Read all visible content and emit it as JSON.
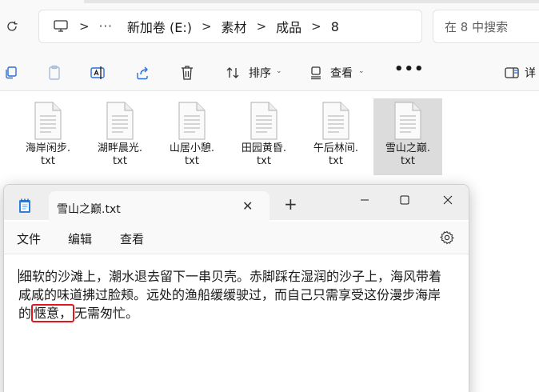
{
  "explorer": {
    "breadcrumb": {
      "more": "···",
      "separator": ">",
      "items": [
        "新加卷 (E:)",
        "素材",
        "成品",
        "8"
      ]
    },
    "search": {
      "placeholder": "在 8 中搜索"
    },
    "toolbar": {
      "sort_label": "排序",
      "view_label": "查看",
      "details_label": "详",
      "more_label": "•••"
    },
    "files": [
      {
        "line1": "海岸闲步.",
        "line2": "txt",
        "selected": false
      },
      {
        "line1": "湖畔晨光.",
        "line2": "txt",
        "selected": false
      },
      {
        "line1": "山居小憩.",
        "line2": "txt",
        "selected": false
      },
      {
        "line1": "田园黄昏.",
        "line2": "txt",
        "selected": false
      },
      {
        "line1": "午后林间.",
        "line2": "txt",
        "selected": false
      },
      {
        "line1": "雪山之巅.",
        "line2": "txt",
        "selected": true
      }
    ]
  },
  "notepad": {
    "tab_title": "雪山之巅.txt",
    "tab_close": "✕",
    "new_tab": "+",
    "menus": [
      "文件",
      "编辑",
      "查看"
    ],
    "content": {
      "line1": "细软的沙滩上，潮水退去留下一串贝壳。赤脚踩在湿润的沙子上，海风带着",
      "line2": "咸咸的味道拂过脸颊。远处的渔船缓缓驶过，而自己只需享受这份漫步海岸",
      "line3_before": "的",
      "line3_highlight": "惬意，",
      "line3_after": "无需匆忙。"
    }
  },
  "colors": {
    "highlight_border": "#e3171b",
    "selected_file_bg": "#dcdcdc",
    "notepad_icon": "#2f7fd8"
  }
}
